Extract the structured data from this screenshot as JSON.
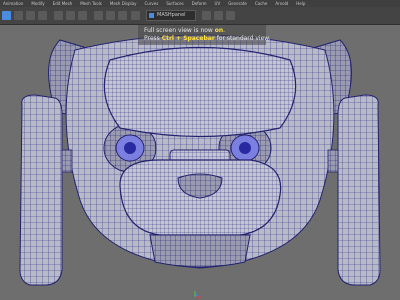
{
  "menu": {
    "items": [
      "Animation",
      "Modify",
      "Edit Mesh",
      "Mesh Tools",
      "Mesh Display",
      "Curves",
      "Surfaces",
      "Deform",
      "UV",
      "Generate",
      "Cache",
      "Arnold",
      "Help"
    ]
  },
  "toolbar": {
    "search_value": "MASHpanel"
  },
  "hud": {
    "line1_pre": "Full screen view is now ",
    "line1_hl": "on",
    "line1_post": ".",
    "line2_pre": "Press ",
    "line2_hl": "Ctrl + Spacebar",
    "line2_post": " for standard view."
  },
  "colors": {
    "viewport_bg": "#6e6e6e",
    "mesh_fill": "#b9bac8",
    "wireframe": "#2a2a8a",
    "highlight": "#ffe040"
  }
}
